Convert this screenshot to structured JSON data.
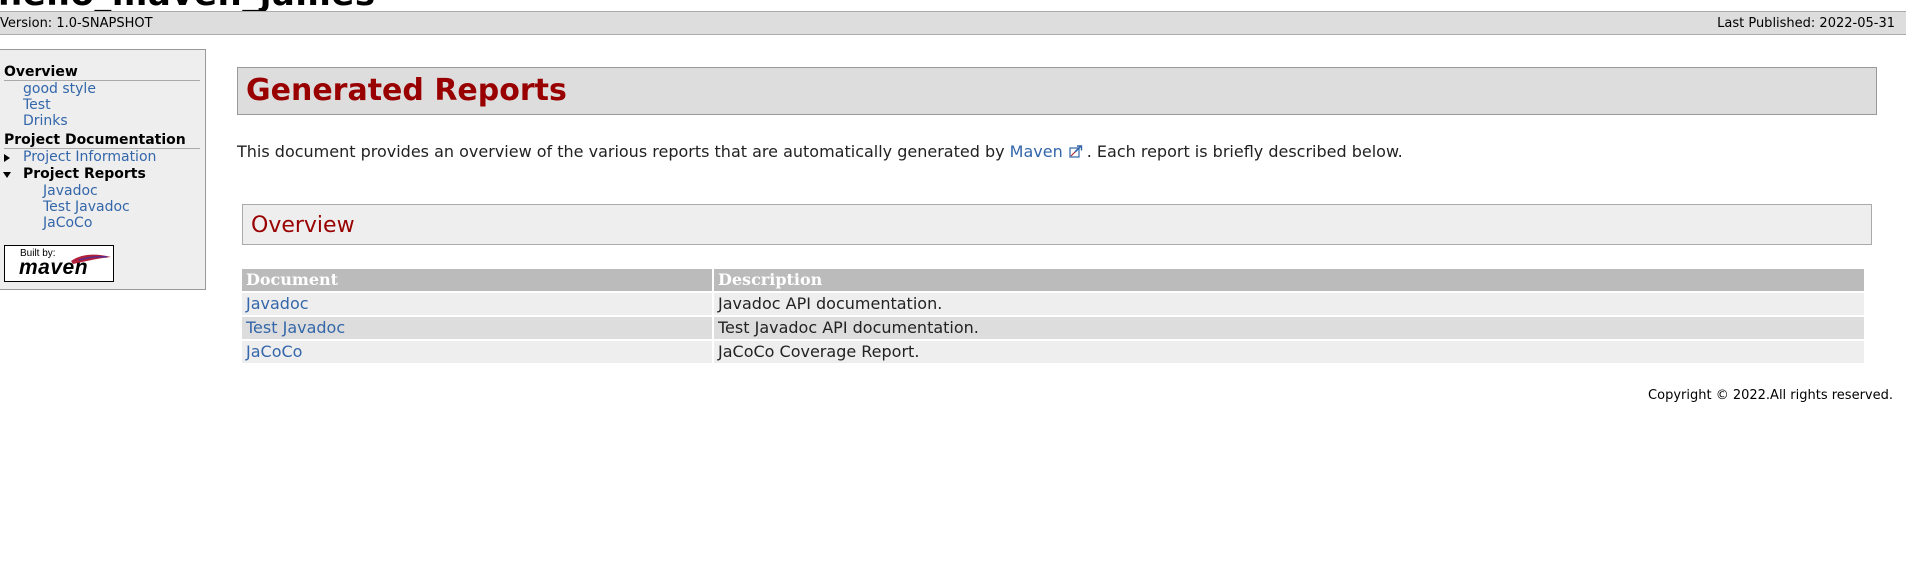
{
  "banner": {
    "title": "hello_maven_james"
  },
  "breadcrumbs": {
    "version": "Version: 1.0-SNAPSHOT",
    "last_published": "Last Published: 2022-05-31"
  },
  "navigation": {
    "overview_heading": "Overview",
    "overview_items": [
      "good style",
      "Test",
      "Drinks"
    ],
    "project_docs_heading": "Project Documentation",
    "project_information": "Project Information",
    "project_reports": "Project Reports",
    "report_items": [
      "Javadoc",
      "Test Javadoc",
      "JaCoCo"
    ],
    "badge": {
      "built_by": "Built by:",
      "word": "maven"
    }
  },
  "main": {
    "title": "Generated Reports",
    "intro_before": "This document provides an overview of the various reports that are automatically generated by ",
    "intro_link": "Maven",
    "intro_after": ". Each report is briefly described below.",
    "overview_heading": "Overview",
    "table": {
      "headers": [
        "Document",
        "Description"
      ],
      "rows": [
        {
          "document": "Javadoc",
          "description": "Javadoc API documentation."
        },
        {
          "document": "Test Javadoc",
          "description": "Test Javadoc API documentation."
        },
        {
          "document": "JaCoCo",
          "description": "JaCoCo Coverage Report."
        }
      ]
    }
  },
  "footer": {
    "copyright": "Copyright © 2022.All rights reserved."
  },
  "colors": {
    "heading_red": "#990000",
    "link_blue": "#3366aa",
    "bar_gray": "#dddddd",
    "table_header": "#bbbbbb"
  },
  "icons": {
    "external_link": "external-link-icon",
    "collapsed": "triangle-right-icon",
    "expanded": "triangle-down-icon",
    "maven_feather": "maven-feather-icon"
  }
}
